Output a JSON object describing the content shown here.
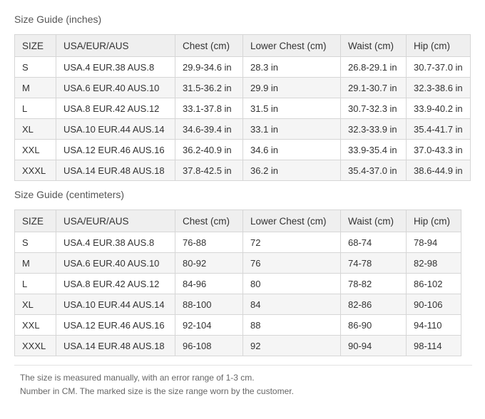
{
  "inches": {
    "title": "Size Guide (inches)",
    "headers": [
      "SIZE",
      "USA/EUR/AUS",
      "Chest (cm)",
      "Lower Chest (cm)",
      "Waist (cm)",
      "Hip (cm)"
    ],
    "rows": [
      [
        "S",
        "USA.4 EUR.38 AUS.8",
        "29.9-34.6 in",
        "28.3 in",
        "26.8-29.1 in",
        "30.7-37.0 in"
      ],
      [
        "M",
        "USA.6 EUR.40 AUS.10",
        "31.5-36.2 in",
        "29.9 in",
        "29.1-30.7 in",
        "32.3-38.6 in"
      ],
      [
        "L",
        "USA.8 EUR.42 AUS.12",
        "33.1-37.8 in",
        "31.5 in",
        "30.7-32.3 in",
        "33.9-40.2 in"
      ],
      [
        "XL",
        "USA.10 EUR.44 AUS.14",
        "34.6-39.4 in",
        "33.1 in",
        "32.3-33.9 in",
        "35.4-41.7 in"
      ],
      [
        "XXL",
        "USA.12 EUR.46 AUS.16",
        "36.2-40.9 in",
        "34.6 in",
        "33.9-35.4 in",
        "37.0-43.3 in"
      ],
      [
        "XXXL",
        "USA.14 EUR.48 AUS.18",
        "37.8-42.5 in",
        "36.2 in",
        "35.4-37.0 in",
        "38.6-44.9 in"
      ]
    ]
  },
  "centimeters": {
    "title": "Size Guide (centimeters)",
    "headers": [
      "SIZE",
      "USA/EUR/AUS",
      "Chest (cm)",
      "Lower Chest (cm)",
      "Waist (cm)",
      "Hip (cm)"
    ],
    "rows": [
      [
        "S",
        "USA.4 EUR.38 AUS.8",
        "76-88",
        "72",
        "68-74",
        "78-94"
      ],
      [
        "M",
        "USA.6 EUR.40 AUS.10",
        "80-92",
        "76",
        "74-78",
        "82-98"
      ],
      [
        "L",
        "USA.8 EUR.42 AUS.12",
        "84-96",
        "80",
        "78-82",
        "86-102"
      ],
      [
        "XL",
        "USA.10 EUR.44 AUS.14",
        "88-100",
        "84",
        "82-86",
        "90-106"
      ],
      [
        "XXL",
        "USA.12 EUR.46 AUS.16",
        "92-104",
        "88",
        "86-90",
        "94-110"
      ],
      [
        "XXXL",
        "USA.14 EUR.48 AUS.18",
        "96-108",
        "92",
        "90-94",
        "98-114"
      ]
    ]
  },
  "notes": {
    "line1": "The size is measured manually, with an error range of 1-3 cm.",
    "line2": "Number in CM. The marked size is the size range worn by the customer."
  }
}
